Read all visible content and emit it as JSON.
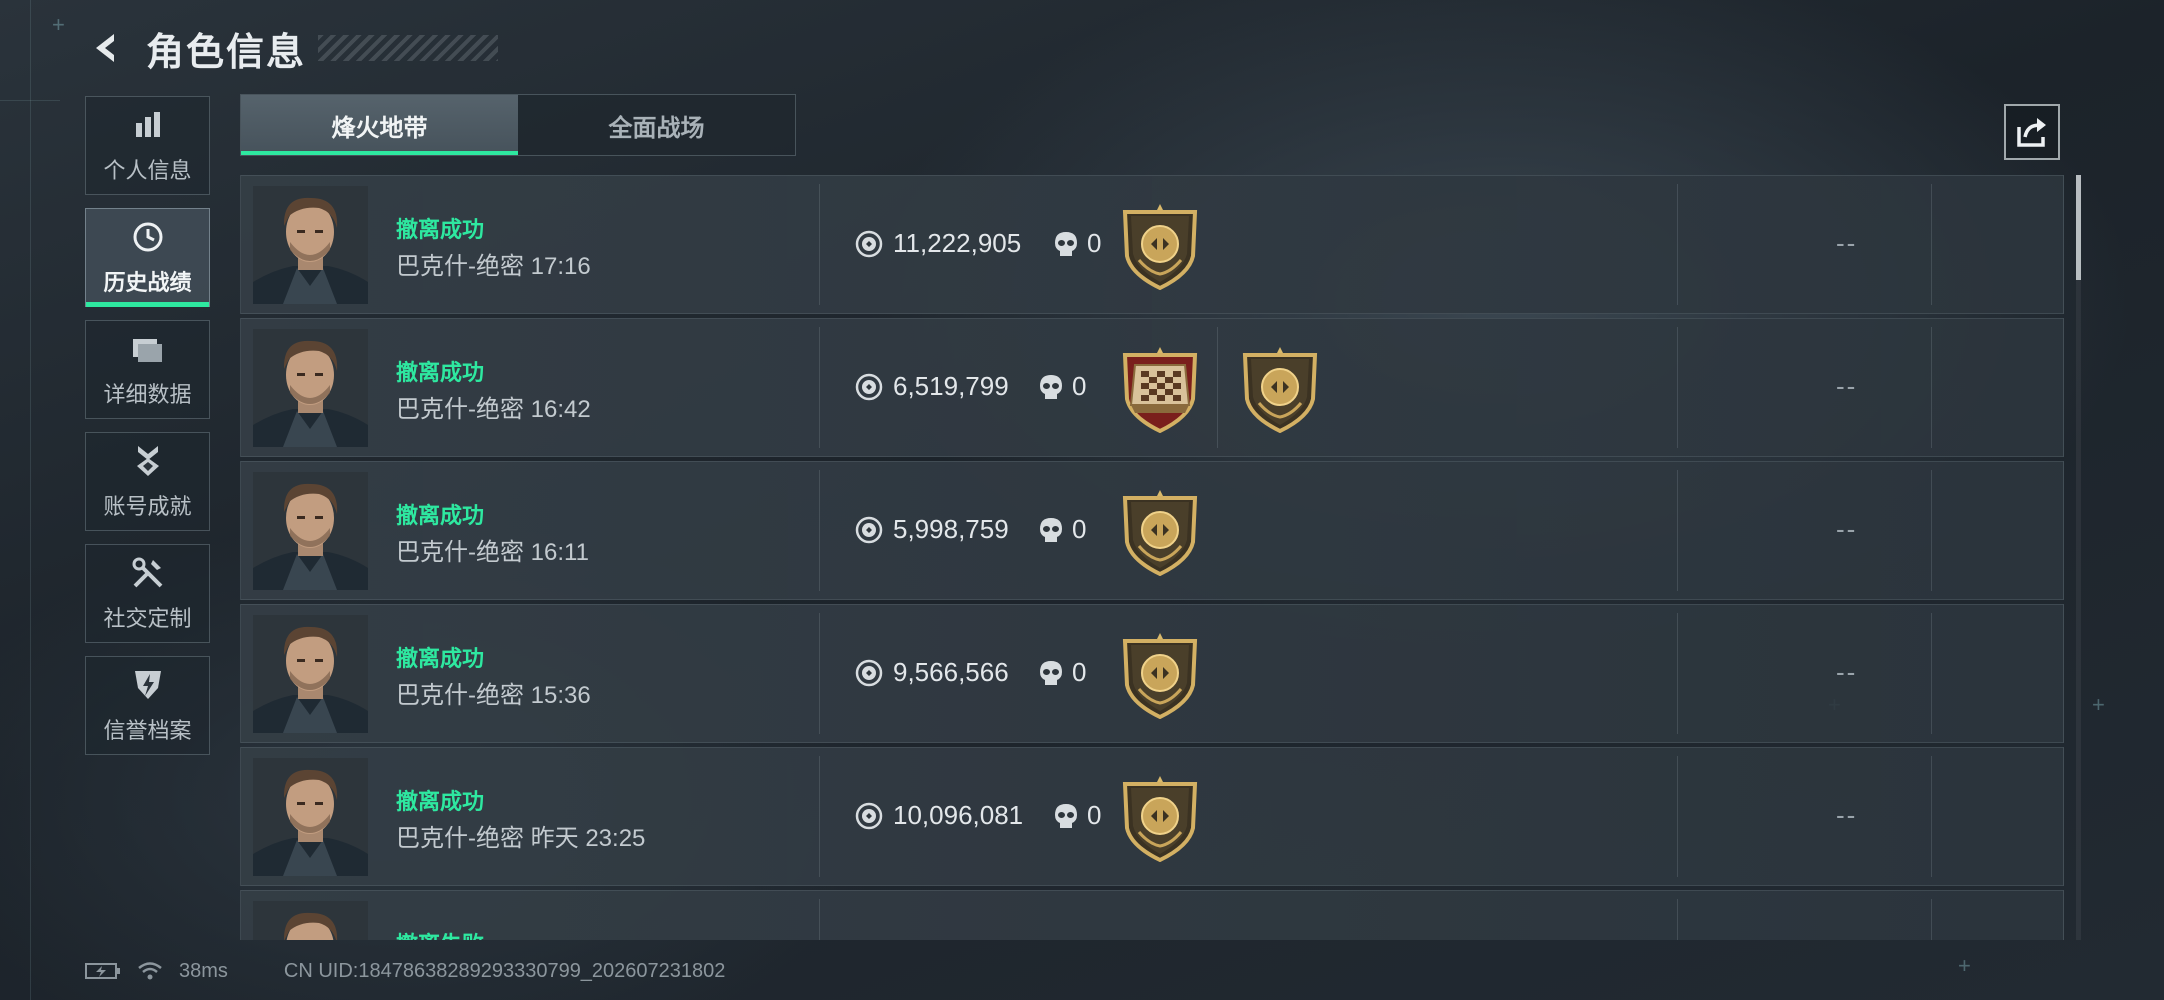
{
  "header": {
    "title": "角色信息"
  },
  "sidebar": {
    "items": [
      {
        "label": "个人信息",
        "icon": "bar-chart-icon",
        "active": false
      },
      {
        "label": "历史战绩",
        "icon": "clock-icon",
        "active": true
      },
      {
        "label": "详细数据",
        "icon": "folder-icon",
        "active": false
      },
      {
        "label": "账号成就",
        "icon": "medal-icon",
        "active": false
      },
      {
        "label": "社交定制",
        "icon": "tools-icon",
        "active": false
      },
      {
        "label": "信誉档案",
        "icon": "shield-bolt-icon",
        "active": false
      }
    ]
  },
  "tabs": [
    {
      "label": "烽火地带",
      "active": true
    },
    {
      "label": "全面战场",
      "active": false
    }
  ],
  "records": [
    {
      "status": "撤离成功",
      "map": "巴克什-绝密",
      "time": "17:16",
      "value": "11,222,905",
      "kills": "0",
      "badges": [
        "gold-crest-badge-icon"
      ],
      "extra": "--"
    },
    {
      "status": "撤离成功",
      "map": "巴克什-绝密",
      "time": "16:42",
      "value": "6,519,799",
      "kills": "0",
      "badges": [
        "chessboard-badge-icon",
        "gold-crest-badge-icon"
      ],
      "extra": "--"
    },
    {
      "status": "撤离成功",
      "map": "巴克什-绝密",
      "time": "16:11",
      "value": "5,998,759",
      "kills": "0",
      "badges": [
        "gold-crest-badge-icon"
      ],
      "extra": "--"
    },
    {
      "status": "撤离成功",
      "map": "巴克什-绝密",
      "time": "15:36",
      "value": "9,566,566",
      "kills": "0",
      "badges": [
        "gold-crest-badge-icon"
      ],
      "extra": "--"
    },
    {
      "status": "撤离成功",
      "map": "巴克什-绝密",
      "time": "昨天 23:25",
      "value": "10,096,081",
      "kills": "0",
      "badges": [
        "gold-crest-badge-icon"
      ],
      "extra": "--"
    },
    {
      "status": "撤离失败",
      "map": "",
      "time": "",
      "value": "",
      "kills": "",
      "badges": [],
      "extra": ""
    }
  ],
  "footer": {
    "ping": "38ms",
    "uid": "CN UID:18478638289293330799_202607231802"
  },
  "colors": {
    "accent": "#2ee8a0",
    "text": "#c3cacf",
    "gold": "#c9a55a"
  }
}
